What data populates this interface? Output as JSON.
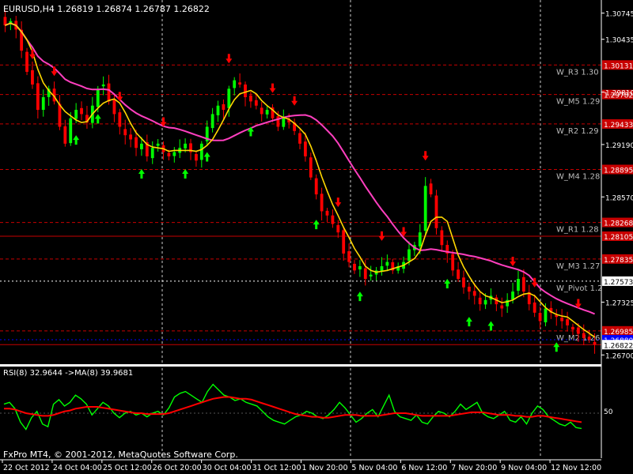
{
  "colors": {
    "background": "#000000",
    "bull_candle": "#00ff00",
    "bear_candle": "#ff0000",
    "fast_ma": "#ffd700",
    "slow_ma": "#ff3fbf",
    "level_line": "#c80000",
    "pivot_line": "#ffffff",
    "blue_line": "#0000ff",
    "up_arrow": "#00ff00",
    "down_arrow": "#ff0000",
    "rsi_line": "#00ff00",
    "rsi_ma_line": "#ff0000",
    "text": "#ffffff",
    "current_price_label_bg": "#ffffff",
    "grid": "#ffffff"
  },
  "main": {
    "header": "EURUSD,H4  1.26819 1.26874 1.26787 1.26822"
  },
  "sub": {
    "header": "RSI(8) 32.9644  ->MA(8) 39.9681",
    "copyright": "FxPro MT4, © 2001-2012, MetaQuotes Software Corp."
  },
  "chart_data": [
    {
      "type": "candlestick",
      "symbol": "EURUSD",
      "timeframe": "H4",
      "ylim": [
        1.266,
        1.309
      ],
      "grid": true,
      "price_ticks": [
        "1.30745",
        "1.30435",
        "1.29810",
        "1.29190",
        "1.28570",
        "1.27325",
        "1.26700"
      ],
      "x_tick_labels": [
        "22 Oct 2012",
        "24 Oct 04:00",
        "25 Oct 12:00",
        "26 Oct 20:00",
        "30 Oct 04:00",
        "31 Oct 12:00",
        "1 Nov 20:00",
        "5 Nov 04:00",
        "6 Nov 12:00",
        "7 Nov 20:00",
        "9 Nov 04:00",
        "12 Nov 12:00"
      ],
      "close": [
        1.306,
        1.3065,
        1.3055,
        1.303,
        1.3005,
        1.299,
        1.296,
        1.2975,
        1.2985,
        1.297,
        1.294,
        1.292,
        1.295,
        1.296,
        1.2955,
        1.2945,
        1.2965,
        1.2985,
        1.299,
        1.297,
        1.2955,
        1.294,
        1.293,
        1.2925,
        1.2915,
        1.292,
        1.2905,
        1.2915,
        1.292,
        1.291,
        1.2905,
        1.291,
        1.2915,
        1.292,
        1.291,
        1.29,
        1.292,
        1.294,
        1.2955,
        1.2965,
        1.296,
        1.2985,
        1.2995,
        1.299,
        1.2975,
        1.297,
        1.2965,
        1.2955,
        1.296,
        1.295,
        1.294,
        1.295,
        1.2945,
        1.2935,
        1.292,
        1.2905,
        1.288,
        1.286,
        1.284,
        1.2835,
        1.2825,
        1.2815,
        1.279,
        1.278,
        1.277,
        1.2775,
        1.276,
        1.2765,
        1.277,
        1.2775,
        1.278,
        1.277,
        1.2775,
        1.278,
        1.2795,
        1.28,
        1.2815,
        1.287,
        1.286,
        1.282,
        1.28,
        1.279,
        1.277,
        1.276,
        1.275,
        1.2745,
        1.274,
        1.273,
        1.2735,
        1.274,
        1.273,
        1.2725,
        1.2735,
        1.2745,
        1.276,
        1.2745,
        1.273,
        1.272,
        1.271,
        1.2725,
        1.272,
        1.2715,
        1.271,
        1.2705,
        1.27,
        1.2695,
        1.269,
        1.2688,
        1.2682
      ],
      "support_resistance_levels": [
        {
          "name": "W_R3",
          "value": 1.30131,
          "price_label": "1.30131",
          "line_label": "W_R3 1.30"
        },
        {
          "name": "W_M5",
          "value": 1.29782,
          "price_label": "1.29782",
          "line_label": "W_M5 1.29"
        },
        {
          "name": "W_R2",
          "value": 1.29433,
          "price_label": "1.29433",
          "line_label": "W_R2 1.29"
        },
        {
          "name": "W_M4",
          "value": 1.28895,
          "price_label": "1.28895",
          "line_label": "W_M4 1.28"
        },
        {
          "name": "W_R1",
          "value": 1.28268,
          "price_label": "1.28268",
          "line_label": "W_R1 1.28"
        },
        {
          "name": "level",
          "value": 1.28105,
          "price_label": "1.28105",
          "line_label": ""
        },
        {
          "name": "W_M3",
          "value": 1.27835,
          "price_label": "1.27835",
          "line_label": "W_M3 1.27"
        },
        {
          "name": "W_Pivot",
          "value": 1.27573,
          "price_label": "1.27573",
          "line_label": "W_Pivot 1.2"
        },
        {
          "name": "W_M2",
          "value": 1.26985,
          "price_label": "1.26985",
          "line_label": "W_M2 1.26"
        },
        {
          "name": "blue",
          "value": 1.2688,
          "price_label": "1.26880",
          "line_label": ""
        },
        {
          "name": "bottom",
          "value": 1.26822,
          "price_label": "1.26822",
          "line_label": ""
        }
      ]
    },
    {
      "type": "line",
      "title": "RSI(8) 32.9644  ->MA(8) 39.9681",
      "ylim": [
        0,
        100
      ],
      "y_tick_labels": [
        "50"
      ],
      "series": [
        {
          "name": "RSI(8)",
          "values": [
            60,
            62,
            55,
            40,
            32,
            45,
            52,
            38,
            35,
            60,
            65,
            58,
            62,
            70,
            66,
            60,
            48,
            55,
            62,
            58,
            50,
            45,
            50,
            52,
            48,
            50,
            46,
            50,
            52,
            48,
            56,
            68,
            72,
            74,
            70,
            66,
            62,
            74,
            82,
            76,
            70,
            68,
            64,
            66,
            62,
            60,
            58,
            52,
            46,
            42,
            40,
            38,
            42,
            46,
            48,
            52,
            50,
            46,
            44,
            48,
            54,
            62,
            56,
            48,
            40,
            44,
            50,
            54,
            46,
            58,
            70,
            52,
            46,
            44,
            42,
            48,
            40,
            38,
            46,
            52,
            50,
            46,
            52,
            60,
            54,
            58,
            62,
            50,
            46,
            44,
            48,
            52,
            42,
            40,
            46,
            38,
            50,
            58,
            54,
            46,
            42,
            38,
            36,
            40,
            34,
            33
          ]
        },
        {
          "name": "->MA(8)",
          "values": [
            55,
            55,
            54,
            52,
            50,
            49,
            48,
            47,
            47,
            48,
            50,
            52,
            53,
            55,
            56,
            57,
            57,
            57,
            56,
            55,
            54,
            53,
            52,
            51,
            50,
            50,
            49,
            49,
            49,
            49,
            50,
            52,
            54,
            56,
            58,
            60,
            62,
            64,
            66,
            67,
            68,
            68,
            67,
            66,
            66,
            65,
            63,
            61,
            59,
            57,
            55,
            53,
            51,
            49,
            48,
            47,
            46,
            46,
            45,
            45,
            46,
            47,
            48,
            48,
            48,
            47,
            47,
            47,
            47,
            48,
            49,
            50,
            50,
            50,
            49,
            48,
            47,
            47,
            47,
            47,
            47,
            47,
            48,
            49,
            50,
            51,
            51,
            51,
            50,
            49,
            48,
            48,
            48,
            47,
            47,
            46,
            46,
            47,
            47,
            46,
            45,
            44,
            43,
            42,
            41,
            40
          ]
        }
      ]
    }
  ]
}
